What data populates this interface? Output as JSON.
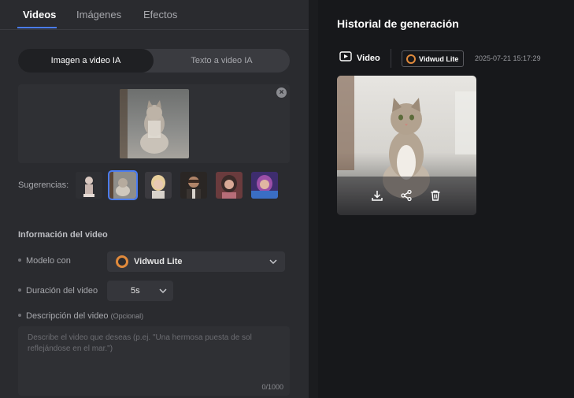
{
  "tabs": [
    {
      "label": "Videos",
      "active": true
    },
    {
      "label": "Imágenes",
      "active": false
    },
    {
      "label": "Efectos",
      "active": false
    }
  ],
  "mode": {
    "active_label": "Imagen a video IA",
    "inactive_label": "Texto a video IA"
  },
  "upload": {
    "close_icon": "close-icon"
  },
  "suggestions": {
    "label": "Sugerencias:"
  },
  "video_info": {
    "title": "Información del video",
    "model_label": "Modelo con",
    "model_value": "Vidwud Lite",
    "duration_label": "Duración del video",
    "duration_value": "5s",
    "description_label": "Descripción del video",
    "description_optional": "(Opcional)",
    "description_placeholder": "Describe el video que deseas (p.ej. \"Una hermosa puesta de sol reflejándose en el mar.\")",
    "description_counter": "0/1000"
  },
  "history": {
    "title": "Historial de generación",
    "type_label": "Video",
    "model_badge": "Vidwud Lite",
    "timestamp": "2025-07-21 15:17:29"
  },
  "colors": {
    "accent": "#4a7cf2",
    "panel": "#2a2b2f",
    "background": "#17181b",
    "model_icon": "#e08a3c"
  }
}
